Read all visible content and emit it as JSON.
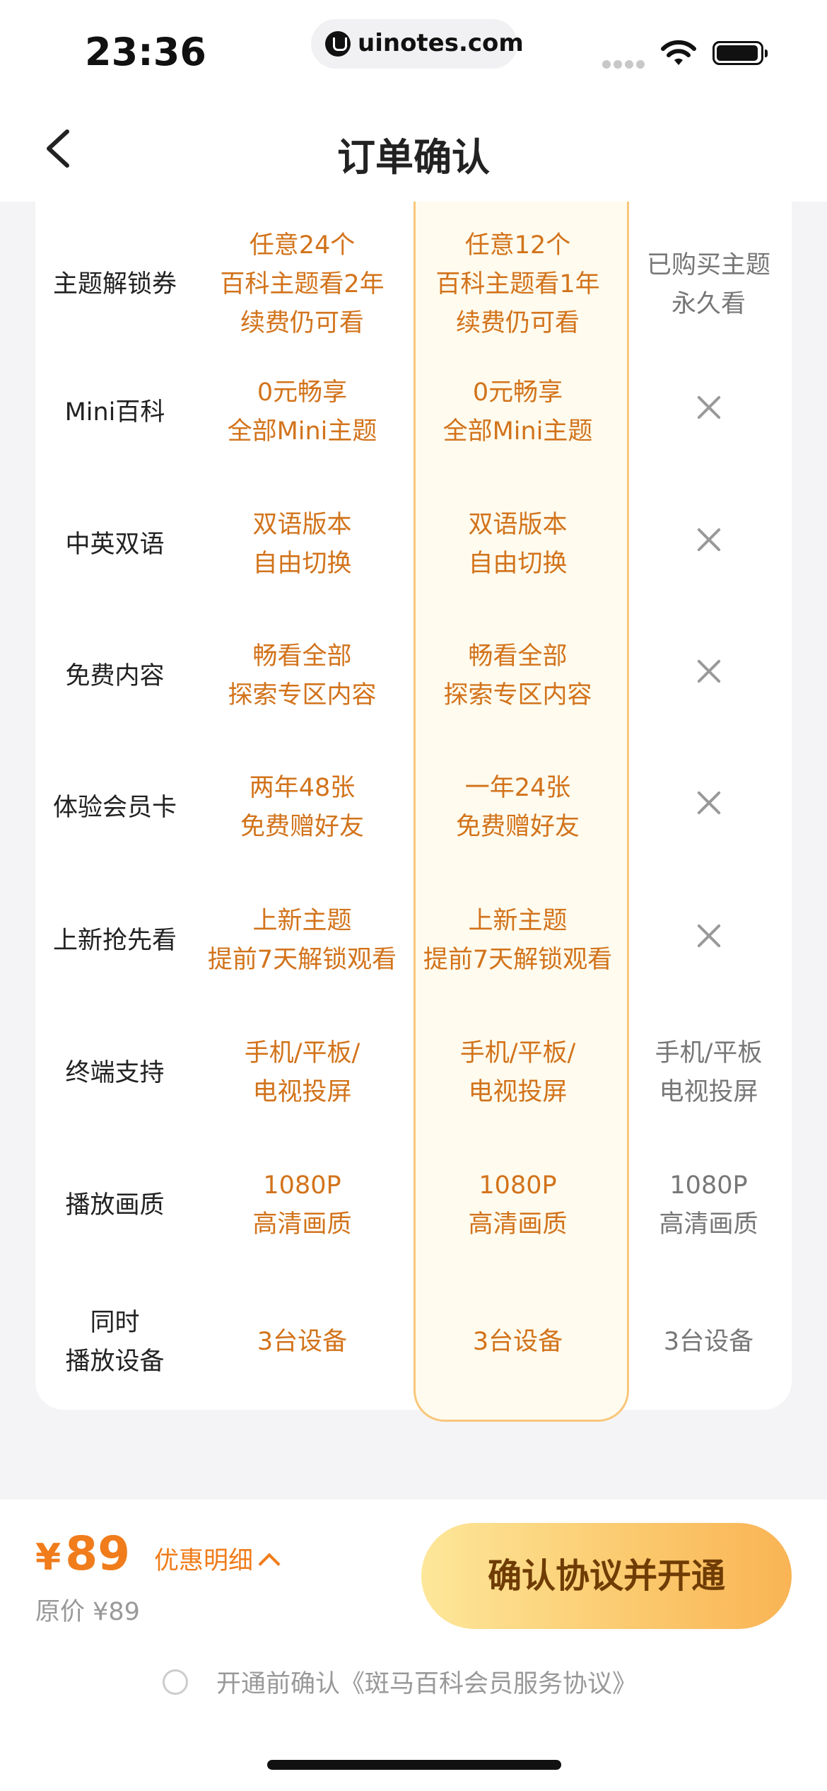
{
  "status": {
    "time": "23:36",
    "url": "uinotes.com"
  },
  "nav": {
    "title": "订单确认"
  },
  "rows": [
    {
      "label": "主题解锁券",
      "a": "任意24个\n百科主题看2年\n续费仍可看",
      "b": "任意12个\n百科主题看1年\n续费仍可看",
      "c": "已购买主题\n永久看"
    },
    {
      "label": "Mini百科",
      "a": "0元畅享\n全部Mini主题",
      "b": "0元畅享\n全部Mini主题",
      "c": ""
    },
    {
      "label": "中英双语",
      "a": "双语版本\n自由切换",
      "b": "双语版本\n自由切换",
      "c": ""
    },
    {
      "label": "免费内容",
      "a": "畅看全部\n探索专区内容",
      "b": "畅看全部\n探索专区内容",
      "c": ""
    },
    {
      "label": "体验会员卡",
      "a": "两年48张\n免费赠好友",
      "b": "一年24张\n免费赠好友",
      "c": ""
    },
    {
      "label": "上新抢先看",
      "a": "上新主题\n提前7天解锁观看",
      "b": "上新主题\n提前7天解锁观看",
      "c": ""
    },
    {
      "label": "终端支持",
      "a": "手机/平板/\n电视投屏",
      "b": "手机/平板/\n电视投屏",
      "c": "手机/平板\n电视投屏"
    },
    {
      "label": "播放画质",
      "a": "1080P\n高清画质",
      "b": "1080P\n高清画质",
      "c": "1080P\n高清画质"
    },
    {
      "label": "同时\n播放设备",
      "a": "3台设备",
      "b": "3台设备",
      "c": "3台设备"
    }
  ],
  "footer": {
    "price_symbol": "¥",
    "price": "89",
    "discount_label": "优惠明细",
    "original_price": "原价 ¥89",
    "cta_label": "确认协议并开通",
    "agreement": "开通前确认《斑马百科会员服务协议》"
  }
}
